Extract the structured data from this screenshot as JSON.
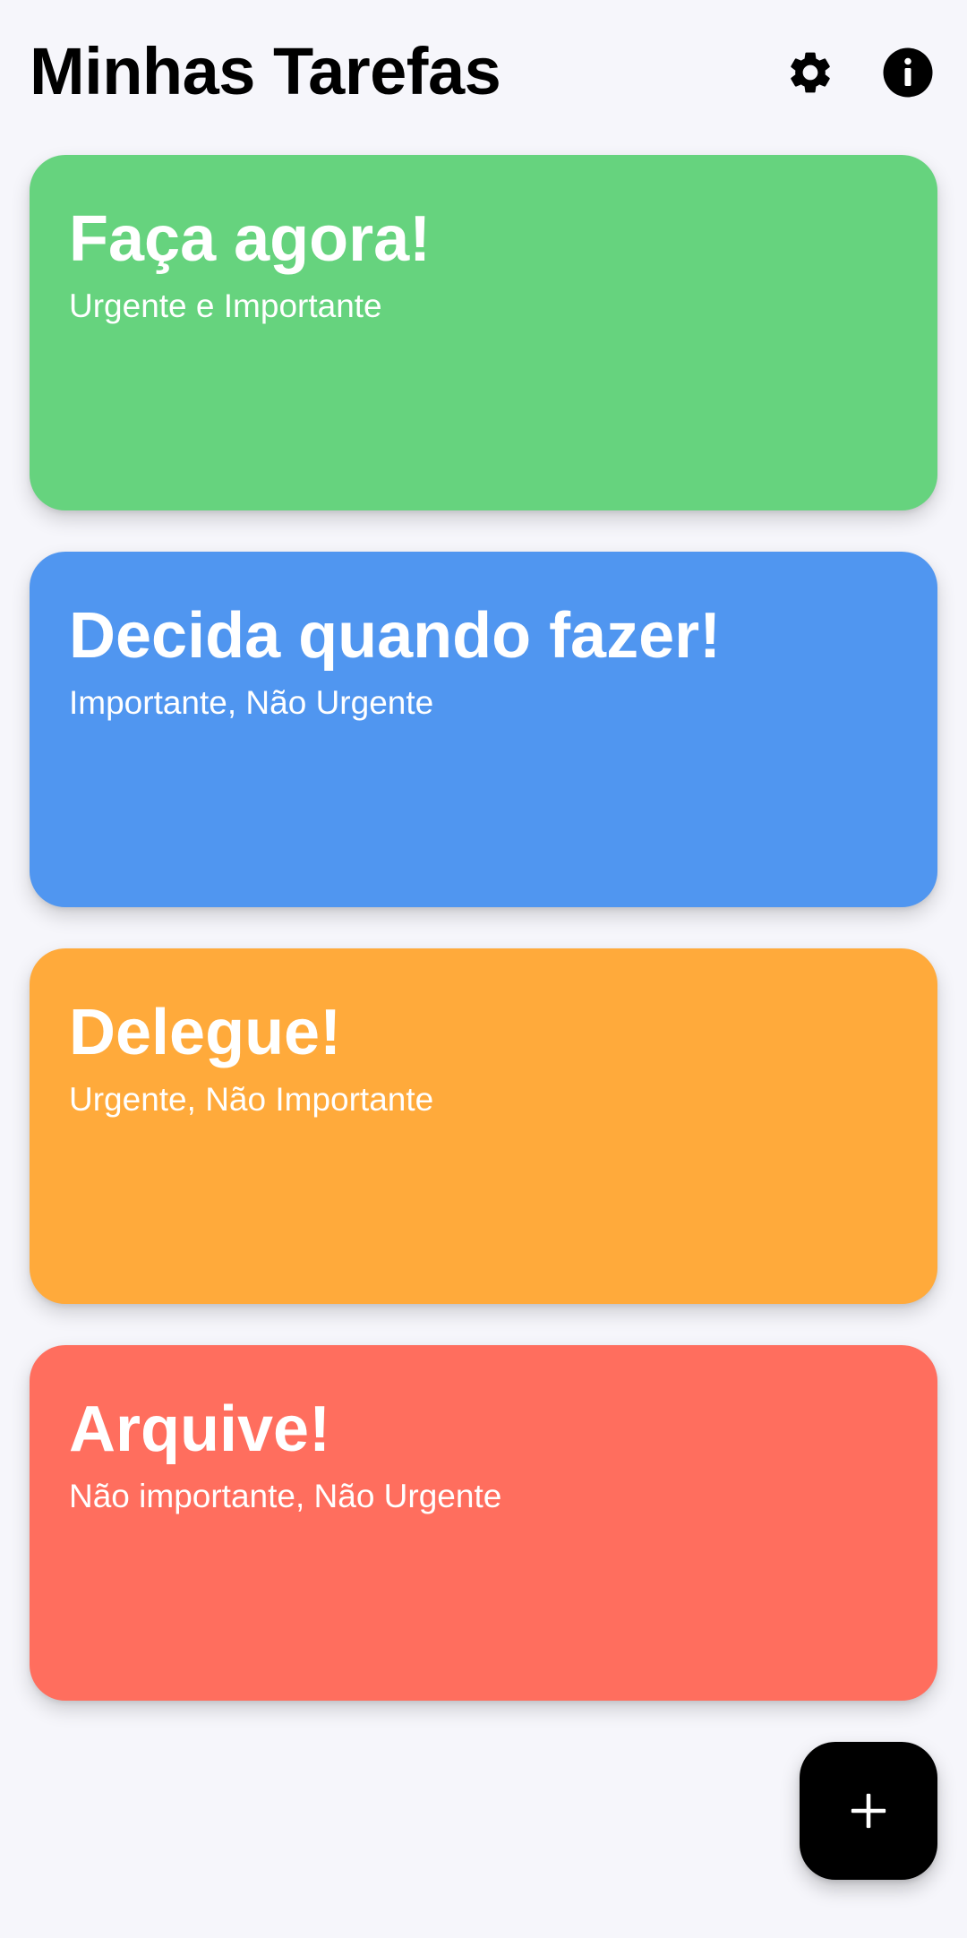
{
  "header": {
    "title": "Minhas Tarefas",
    "settings_icon": "gear-icon",
    "info_icon": "info-icon"
  },
  "quadrants": [
    {
      "title": "Faça agora!",
      "subtitle": "Urgente e Importante",
      "color": "#66d37e"
    },
    {
      "title": "Decida quando fazer!",
      "subtitle": "Importante, Não Urgente",
      "color": "#5096f0"
    },
    {
      "title": "Delegue!",
      "subtitle": "Urgente, Não Importante",
      "color": "#ffaa3b"
    },
    {
      "title": "Arquive!",
      "subtitle": "Não importante, Não Urgente",
      "color": "#ff6e5e"
    }
  ],
  "fab": {
    "icon": "plus-icon",
    "color": "#000000"
  },
  "colors": {
    "background": "#f6f6fb",
    "text_primary": "#000000",
    "card_text": "#ffffff"
  }
}
